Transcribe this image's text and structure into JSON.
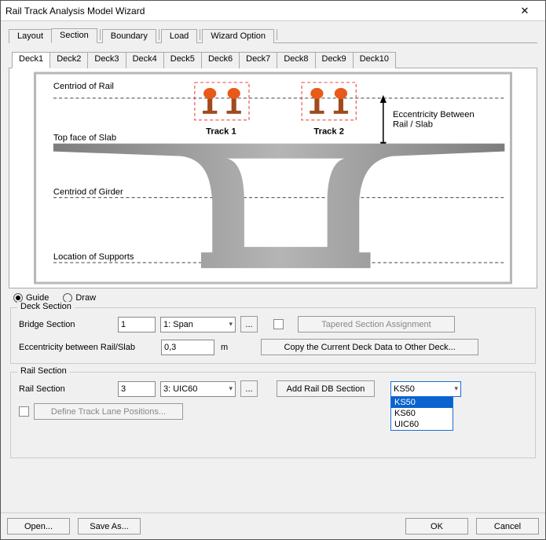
{
  "window": {
    "title": "Rail Track Analysis Model Wizard",
    "close_glyph": "✕"
  },
  "main_tabs": [
    "Layout",
    "Section",
    "Boundary",
    "Load",
    "Wizard Option"
  ],
  "main_tab_active": 1,
  "deck_tabs": [
    "Deck1",
    "Deck2",
    "Deck3",
    "Deck4",
    "Deck5",
    "Deck6",
    "Deck7",
    "Deck8",
    "Deck9",
    "Deck10"
  ],
  "deck_tab_active": 0,
  "diagram": {
    "labels": {
      "centriod_rail": "Centriod of Rail",
      "top_face_slab": "Top face of Slab",
      "centriod_girder": "Centriod of Girder",
      "location_supports": "Location of Supports",
      "track1": "Track 1",
      "track2": "Track 2",
      "ecc": "Eccentricity Between\nRail / Slab"
    }
  },
  "mode": {
    "guide": "Guide",
    "draw": "Draw",
    "selected": "guide"
  },
  "deck_section": {
    "title": "Deck Section",
    "bridge_section_label": "Bridge Section",
    "bridge_section_num": "1",
    "bridge_section_combo": "1: Span",
    "browse_glyph": "...",
    "tapered_label": "Tapered Section Assignment",
    "ecc_label": "Eccentricity between Rail/Slab",
    "ecc_value": "0,3",
    "ecc_unit": "m",
    "copy_button": "Copy the Current Deck Data to Other Deck..."
  },
  "rail_section": {
    "title": "Rail Section",
    "label": "Rail Section",
    "num": "3",
    "combo": "3: UIC60",
    "browse_glyph": "...",
    "add_db_button": "Add Rail DB Section",
    "db_combo_selected": "KS50",
    "db_options": [
      "KS50",
      "KS60",
      "UIC60"
    ],
    "define_lane_button": "Define Track Lane Positions..."
  },
  "footer": {
    "open": "Open...",
    "save": "Save As...",
    "ok": "OK",
    "cancel": "Cancel"
  }
}
